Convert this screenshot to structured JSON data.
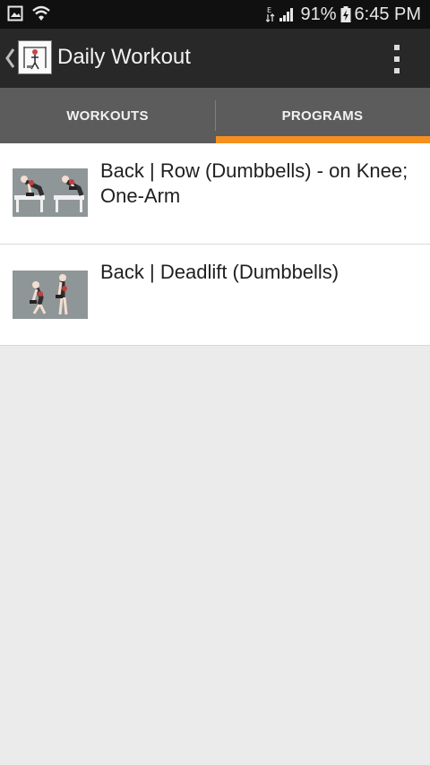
{
  "status_bar": {
    "battery_percent": "91%",
    "time": "6:45 PM",
    "icons": [
      "gallery-icon",
      "wifi-icon",
      "data-arrows-icon",
      "signal-icon",
      "battery-charging-icon"
    ]
  },
  "action_bar": {
    "title": "Daily Workout",
    "icons": [
      "back-chevron-icon",
      "app-logo-icon",
      "overflow-menu-icon"
    ]
  },
  "tabs": [
    {
      "label": "WORKOUTS",
      "selected": false
    },
    {
      "label": "PROGRAMS",
      "selected": true
    }
  ],
  "colors": {
    "accent": "#f5901f",
    "action_bar": "#282828",
    "tab_bar": "#5c5c5c",
    "background": "#ebebeb"
  },
  "exercises": [
    {
      "title": "Back | Row (Dumbbells) - on Knee; One-Arm",
      "thumbnail": "dumbbell-row-figure-icon"
    },
    {
      "title": "Back | Deadlift (Dumbbells)",
      "thumbnail": "dumbbell-deadlift-figure-icon"
    }
  ]
}
